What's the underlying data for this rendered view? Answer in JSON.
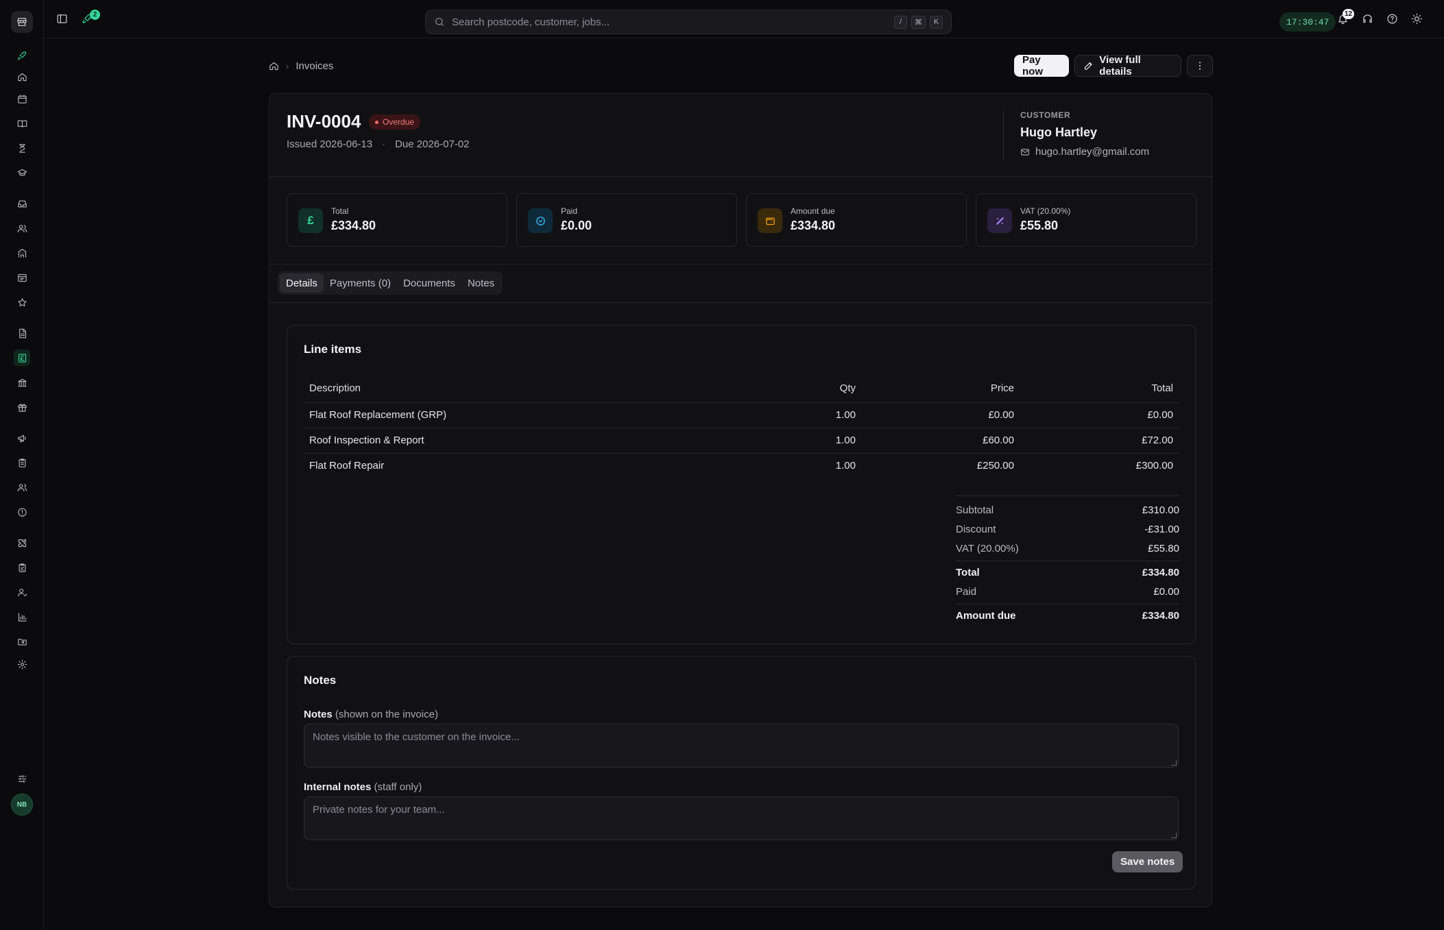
{
  "topbar": {
    "rocket_badge": "2",
    "search_placeholder": "Search postcode, customer, jobs...",
    "shortcut_keys": [
      "/",
      "⌘",
      "K"
    ],
    "clock": "17:30:47",
    "notifications_badge": "12"
  },
  "sidebar": {
    "avatar_initials": "NB",
    "items": [
      "store-icon",
      "rocket-icon",
      "home-icon",
      "calendar-icon",
      "book-icon",
      "hourglass-icon",
      "graduation-cap-icon",
      "inbox-icon",
      "users-icon",
      "building-icon",
      "browser-icon",
      "star-icon",
      "file-text-icon",
      "invoice-pound-icon",
      "bank-icon",
      "gift-icon",
      "megaphone-icon",
      "clipboard-icon",
      "team-icon",
      "alert-circle-icon",
      "puzzle-icon",
      "checklist-icon",
      "user-check-icon",
      "bar-chart-icon",
      "folder-icon",
      "settings-icon",
      "sliders-icon"
    ]
  },
  "breadcrumb": {
    "current": "Invoices"
  },
  "actions": {
    "pay_now": "Pay now",
    "view_full_details": "View full details"
  },
  "invoice": {
    "number": "INV-0004",
    "status": "Overdue",
    "issued": "Issued 2026-06-13",
    "due": "Due 2026-07-02",
    "date_separator": "·"
  },
  "customer": {
    "label": "CUSTOMER",
    "name": "Hugo Hartley",
    "email": "hugo.hartley@gmail.com"
  },
  "stats": [
    {
      "label": "Total",
      "value": "£334.80",
      "icon": "pound-icon",
      "color": "#34d399"
    },
    {
      "label": "Paid",
      "value": "£0.00",
      "icon": "check-circle-icon",
      "color": "#38bdf8"
    },
    {
      "label": "Amount due",
      "value": "£334.80",
      "icon": "wallet-icon",
      "color": "#f59e0b"
    },
    {
      "label": "VAT (20.00%)",
      "value": "£55.80",
      "icon": "percent-icon",
      "color": "#a78bfa"
    }
  ],
  "tabs": [
    "Details",
    "Payments (0)",
    "Documents",
    "Notes"
  ],
  "line_items": {
    "title": "Line items",
    "columns": [
      "Description",
      "Qty",
      "Price",
      "Total"
    ],
    "rows": [
      {
        "description": "Flat Roof Replacement (GRP)",
        "qty": "1.00",
        "price": "£0.00",
        "total": "£0.00"
      },
      {
        "description": "Roof Inspection & Report",
        "qty": "1.00",
        "price": "£60.00",
        "total": "£72.00"
      },
      {
        "description": "Flat Roof Repair",
        "qty": "1.00",
        "price": "£250.00",
        "total": "£300.00"
      }
    ]
  },
  "totals": {
    "subtotal_label": "Subtotal",
    "subtotal": "£310.00",
    "discount_label": "Discount",
    "discount": "-£31.00",
    "vat_label": "VAT (20.00%)",
    "vat": "£55.80",
    "total_label": "Total",
    "total": "£334.80",
    "paid_label": "Paid",
    "paid": "£0.00",
    "due_label": "Amount due",
    "due": "£334.80"
  },
  "notes": {
    "title": "Notes",
    "public_label": "Notes",
    "public_sub": "(shown on the invoice)",
    "public_placeholder": "Notes visible to the customer on the invoice...",
    "internal_label": "Internal notes",
    "internal_sub": "(staff only)",
    "internal_placeholder": "Private notes for your team...",
    "save_label": "Save notes"
  }
}
